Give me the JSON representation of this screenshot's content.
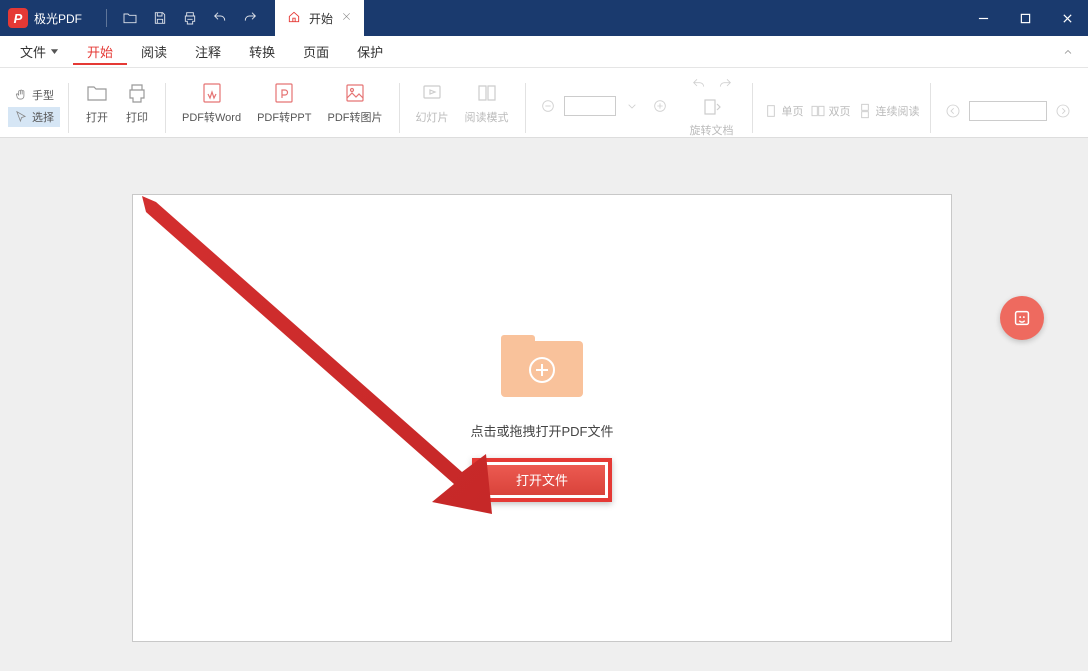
{
  "app": {
    "title": "极光PDF"
  },
  "doc_tab": {
    "label": "开始"
  },
  "menu": {
    "file": "文件",
    "items": [
      "开始",
      "阅读",
      "注释",
      "转换",
      "页面",
      "保护"
    ],
    "active_index": 0
  },
  "ribbon": {
    "hand": "手型",
    "select": "选择",
    "open": "打开",
    "print": "打印",
    "to_word": "PDF转Word",
    "to_ppt": "PDF转PPT",
    "to_image": "PDF转图片",
    "slideshow": "幻灯片",
    "read_mode": "阅读模式",
    "rotate_doc": "旋转文档",
    "single_page": "单页",
    "facing": "双页",
    "continuous": "连续阅读"
  },
  "workspace": {
    "hint": "点击或拖拽打开PDF文件",
    "open_button": "打开文件"
  }
}
